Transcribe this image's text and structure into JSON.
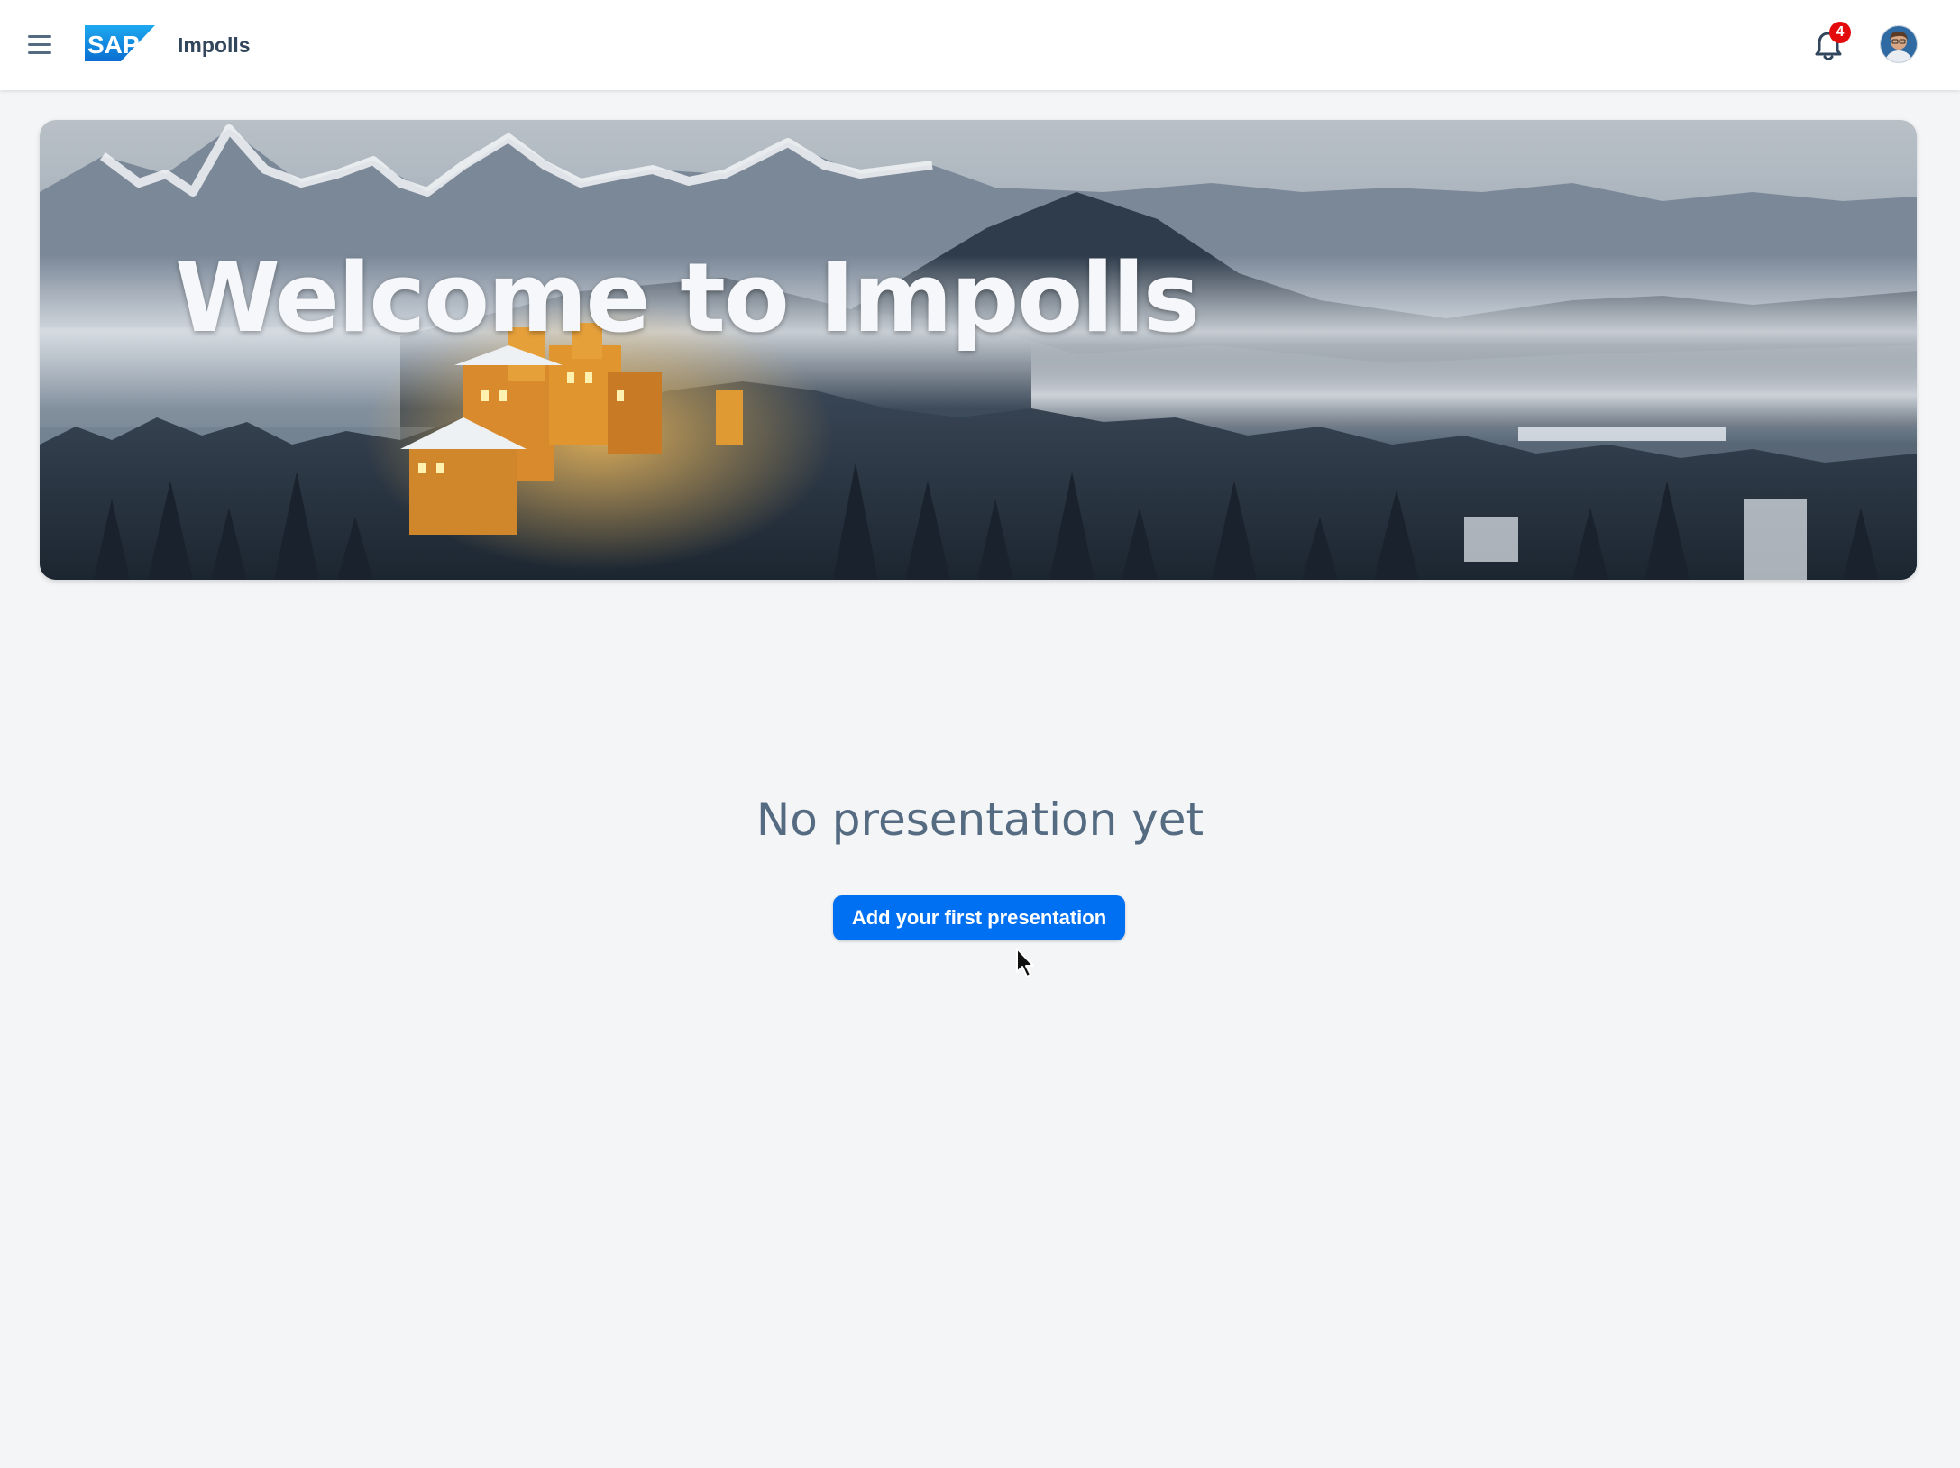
{
  "shellbar": {
    "app_title": "Impolls",
    "logo_text": "SAP",
    "notification_count": "4",
    "menu_icon": "hamburger-menu-icon",
    "bell_icon": "bell-icon",
    "avatar_icon": "user-avatar"
  },
  "banner": {
    "title": "Welcome to Impolls",
    "image": "snowy mountains with castle"
  },
  "main": {
    "empty_title": "No presentation yet",
    "add_button_label": "Add your first presentation"
  },
  "colors": {
    "accent": "#0070f2",
    "badge": "#e30b0b",
    "text": "#556b82",
    "background": "#f4f5f7"
  }
}
